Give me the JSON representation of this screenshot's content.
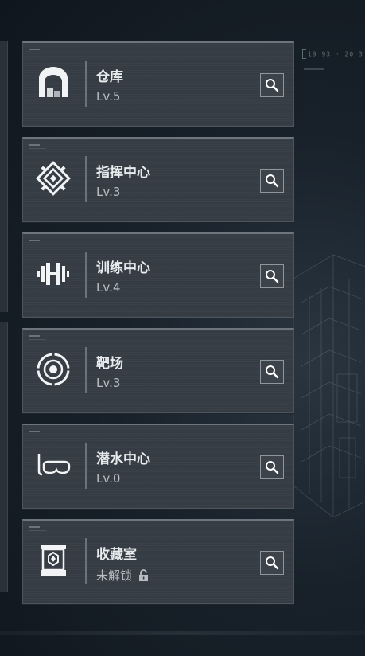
{
  "hud": {
    "readout": "19 93 · 20 3"
  },
  "facilities": [
    {
      "name": "仓库",
      "level": "Lv.5",
      "icon": "warehouse-icon",
      "locked": false
    },
    {
      "name": "指挥中心",
      "level": "Lv.3",
      "icon": "command-center-icon",
      "locked": false
    },
    {
      "name": "训练中心",
      "level": "Lv.4",
      "icon": "dumbbell-icon",
      "locked": false
    },
    {
      "name": "靶场",
      "level": "Lv.3",
      "icon": "target-icon",
      "locked": false
    },
    {
      "name": "潜水中心",
      "level": "Lv.0",
      "icon": "diving-mask-icon",
      "locked": false
    },
    {
      "name": "收藏室",
      "level": "未解锁",
      "icon": "display-case-icon",
      "locked": true
    }
  ],
  "colors": {
    "card_bg": "#353c44",
    "text_primary": "#e9ecee",
    "text_secondary": "#b7bdc2",
    "accent_border": "#6d767f"
  }
}
